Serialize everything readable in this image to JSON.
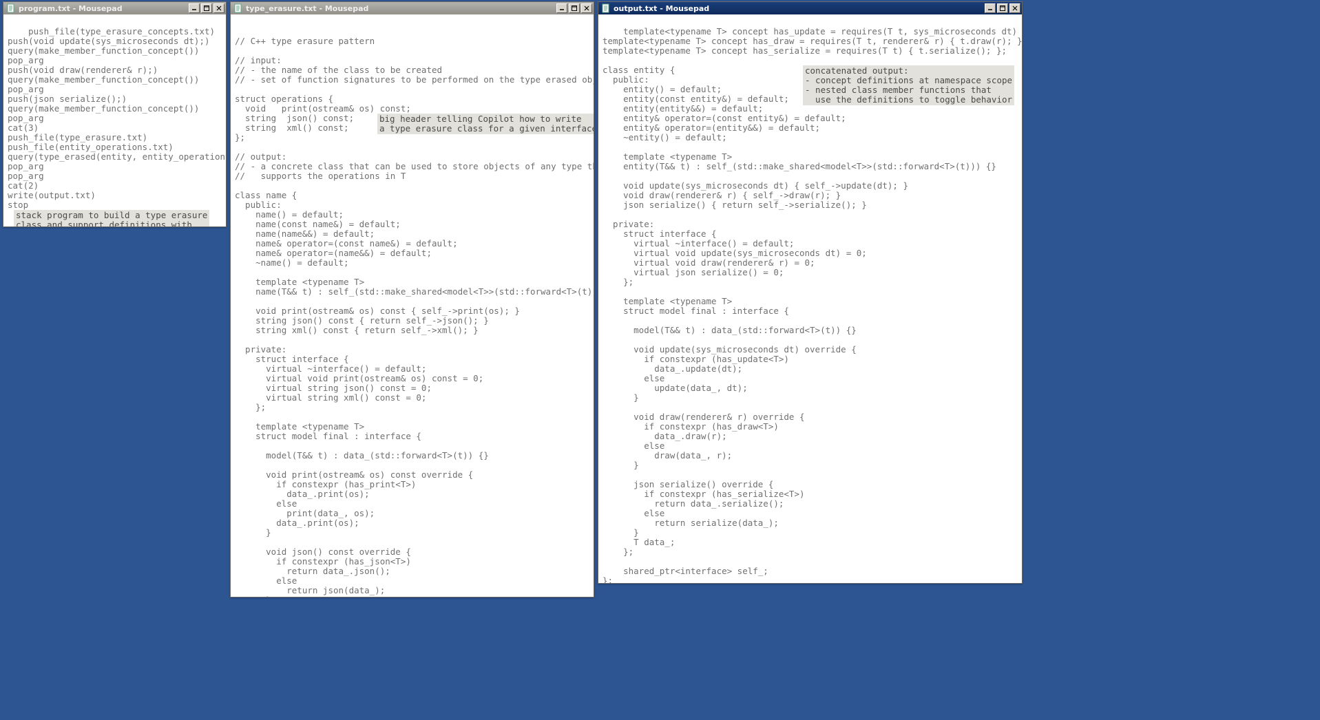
{
  "app_name": "Mousepad",
  "windows": {
    "program": {
      "filename": "program.txt",
      "title": "program.txt - Mousepad",
      "active": false,
      "content": "push_file(type_erasure_concepts.txt)\npush(void update(sys_microseconds dt);)\nquery(make_member_function_concept())\npop_arg\npush(void draw(renderer& r);)\nquery(make_member_function_concept())\npop_arg\npush(json serialize();)\nquery(make_member_function_concept())\npop_arg\ncat(3)\npush_file(type_erasure.txt)\npush_file(entity_operations.txt)\nquery(type_erased(entity, entity_operations))\npop_arg\npop_arg\ncat(2)\nwrite(output.txt)\nstop",
      "annotation": "stack program to build a type erasure\nclass and support definitions with\na chain of Copilot prompts from\nlibrary files"
    },
    "type_erasure": {
      "filename": "type_erasure.txt",
      "title": "type_erasure.txt - Mousepad",
      "active": false,
      "content": "\n// C++ type erasure pattern\n\n// input:\n// - the name of the class to be created\n// - set of function signatures to be performed on the type erased objects:\n\nstruct operations {\n  void   print(ostream& os) const;\n  string  json() const;\n  string  xml() const;\n};\n\n// output:\n// - a concrete class that can be used to store objects of any type that\n//   supports the operations in T\n\nclass name {\n  public:\n    name() = default;\n    name(const name&) = default;\n    name(name&&) = default;\n    name& operator=(const name&) = default;\n    name& operator=(name&&) = default;\n    ~name() = default;\n\n    template <typename T>\n    name(T&& t) : self_(std::make_shared<model<T>>(std::forward<T>(t))) {}\n\n    void print(ostream& os) const { self_->print(os); }\n    string json() const { return self_->json(); }\n    string xml() const { return self_->xml(); }\n\n  private:\n    struct interface {\n      virtual ~interface() = default;\n      virtual void print(ostream& os) const = 0;\n      virtual string json() const = 0;\n      virtual string xml() const = 0;\n    };\n\n    template <typename T>\n    struct model final : interface {\n\n      model(T&& t) : data_(std::forward<T>(t)) {}\n\n      void print(ostream& os) const override {\n        if constexpr (has_print<T>)\n          data_.print(os);\n        else\n          print(data_, os);\n        data_.print(os);\n      }\n\n      void json() const override {\n        if constexpr (has_json<T>)\n          return data_.json();\n        else\n          return json(data_);\n      }",
      "annotation": "big header telling Copilot how to write\na type erasure class for a given interface"
    },
    "output": {
      "filename": "output.txt",
      "title": "output.txt - Mousepad",
      "active": true,
      "content": "template<typename T> concept has_update = requires(T t, sys_microseconds dt) { t.update(dt); };\ntemplate<typename T> concept has_draw = requires(T t, renderer& r) { t.draw(r); };\ntemplate<typename T> concept has_serialize = requires(T t) { t.serialize(); };\n\nclass entity {\n  public:\n    entity() = default;\n    entity(const entity&) = default;\n    entity(entity&&) = default;\n    entity& operator=(const entity&) = default;\n    entity& operator=(entity&&) = default;\n    ~entity() = default;\n\n    template <typename T>\n    entity(T&& t) : self_(std::make_shared<model<T>>(std::forward<T>(t))) {}\n\n    void update(sys_microseconds dt) { self_->update(dt); }\n    void draw(renderer& r) { self_->draw(r); }\n    json serialize() { return self_->serialize(); }\n\n  private:\n    struct interface {\n      virtual ~interface() = default;\n      virtual void update(sys_microseconds dt) = 0;\n      virtual void draw(renderer& r) = 0;\n      virtual json serialize() = 0;\n    };\n\n    template <typename T>\n    struct model final : interface {\n\n      model(T&& t) : data_(std::forward<T>(t)) {}\n\n      void update(sys_microseconds dt) override {\n        if constexpr (has_update<T>)\n          data_.update(dt);\n        else\n          update(data_, dt);\n      }\n\n      void draw(renderer& r) override {\n        if constexpr (has_draw<T>)\n          data_.draw(r);\n        else\n          draw(data_, r);\n      }\n\n      json serialize() override {\n        if constexpr (has_serialize<T>)\n          return data_.serialize();\n        else\n          return serialize(data_);\n      }\n      T data_;\n    };\n\n    shared_ptr<interface> self_;\n};",
      "annotation": "concatenated output:\n- concept definitions at namespace scope\n- nested class member functions that\n  use the definitions to toggle behavior"
    }
  }
}
